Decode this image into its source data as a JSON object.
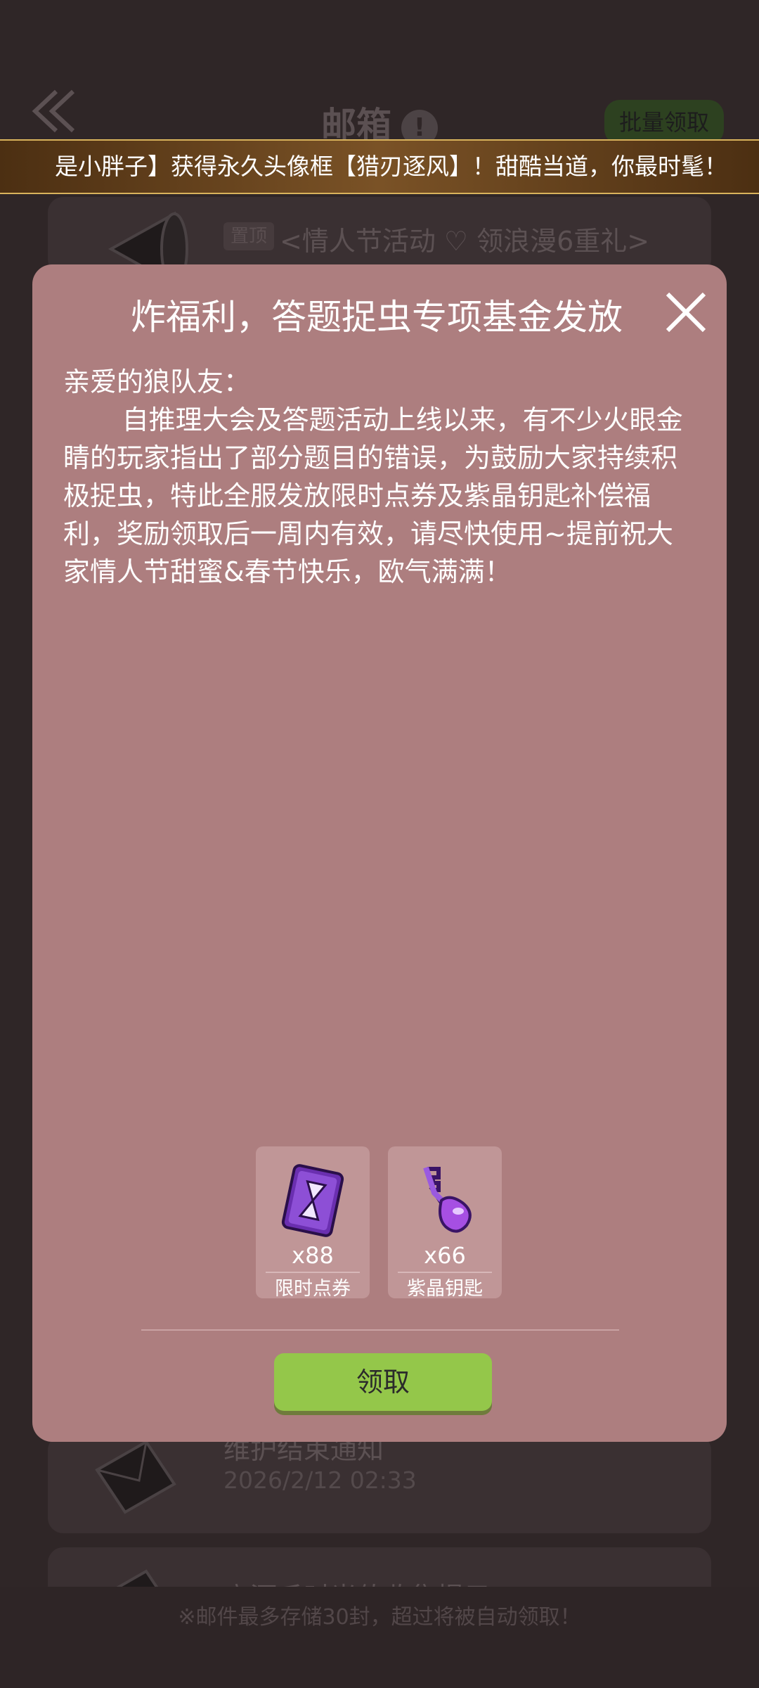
{
  "header": {
    "title": "邮箱",
    "batch_claim_label": "批量领取"
  },
  "ticker": {
    "text": "是小胖子】获得永久头像框【猎刃逐风】！甜酷当道，你最时髦！"
  },
  "mail_list": [
    {
      "tag": "置顶",
      "title": "<情人节活动 ♡ 领浪漫6重礼>"
    },
    {
      "title": "维护结束通知",
      "date": "2026/2/12  02:33"
    },
    {
      "title": "高酒千时光值收集提示"
    }
  ],
  "footer": {
    "note": "※邮件最多存储30封，超过将被自动领取！"
  },
  "modal": {
    "title": "炸福利，答题捉虫专项基金发放",
    "greeting": "亲爱的狼队友：",
    "content": "自推理大会及答题活动上线以来，有不少火眼金睛的玩家指出了部分题目的错误，为鼓励大家持续积极捉虫，特此全服发放限时点券及紫晶钥匙补偿福利，奖励领取后一周内有效，请尽快使用~提前祝大家情人节甜蜜&春节快乐，欧气满满！",
    "rewards": [
      {
        "qty": "x88",
        "name": "限时点券",
        "icon": "hourglass-voucher-icon"
      },
      {
        "qty": "x66",
        "name": "紫晶钥匙",
        "icon": "amethyst-key-icon"
      }
    ],
    "claim_label": "领取"
  },
  "colors": {
    "modal_bg": "#ad7e7f",
    "claim_button": "#94c74a",
    "page_bg": "#2f2627"
  }
}
